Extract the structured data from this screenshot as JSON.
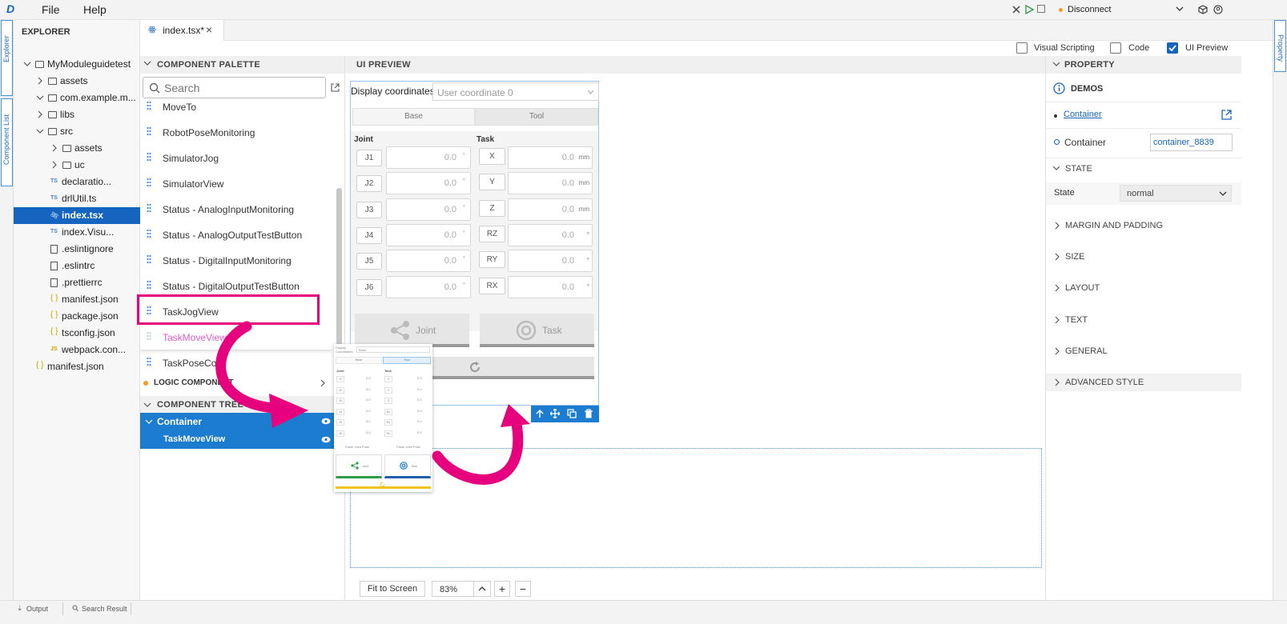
{
  "menu": {
    "file": "File",
    "help": "Help",
    "logo": "D",
    "connection": "Disconnect"
  },
  "rails": {
    "explorer": "Explorer",
    "component_list": "Component List",
    "property": "Property"
  },
  "explorer": {
    "title": "EXPLORER",
    "items": [
      {
        "label": "MyModuleguidetest",
        "kind": "folder",
        "level": 0,
        "open": true
      },
      {
        "label": "assets",
        "kind": "folder",
        "level": 1,
        "open": false
      },
      {
        "label": "com.example.m...",
        "kind": "folder",
        "level": 1,
        "open": true
      },
      {
        "label": "libs",
        "kind": "folder",
        "level": 2,
        "open": false
      },
      {
        "label": "src",
        "kind": "folder",
        "level": 2,
        "open": true
      },
      {
        "label": "assets",
        "kind": "folder",
        "level": 3,
        "open": false
      },
      {
        "label": "uc",
        "kind": "folder",
        "level": 3,
        "open": false
      },
      {
        "label": "declaratio...",
        "kind": "ts",
        "level": 4
      },
      {
        "label": "drlUtil.ts",
        "kind": "ts",
        "level": 4
      },
      {
        "label": "index.tsx",
        "kind": "tsx",
        "level": 4,
        "selected": true
      },
      {
        "label": "index.Visu...",
        "kind": "ts",
        "level": 4
      },
      {
        "label": ".eslintignore",
        "kind": "file",
        "level": 3
      },
      {
        "label": ".eslintrc",
        "kind": "file",
        "level": 3
      },
      {
        "label": ".prettierrc",
        "kind": "file",
        "level": 3
      },
      {
        "label": "manifest.json",
        "kind": "json",
        "level": 3
      },
      {
        "label": "package.json",
        "kind": "json",
        "level": 3
      },
      {
        "label": "tsconfig.json",
        "kind": "json",
        "level": 3
      },
      {
        "label": "webpack.con...",
        "kind": "js",
        "level": 3
      },
      {
        "label": "manifest.json",
        "kind": "json",
        "level": 1
      }
    ],
    "type_badges": {
      "ts": "TS",
      "js": "JS",
      "json": "{ }"
    }
  },
  "editor_tab": {
    "label": "index.tsx*",
    "close": "×"
  },
  "view_toggles": [
    {
      "label": "Visual Scripting",
      "checked": false
    },
    {
      "label": "Code",
      "checked": false
    },
    {
      "label": "UI Preview",
      "checked": true
    }
  ],
  "palette": {
    "title": "COMPONENT PALETTE",
    "search_placeholder": "Search",
    "items": [
      "MoveTo",
      "RobotPoseMonitoring",
      "SimulatorJog",
      "SimulatorView",
      "Status - AnalogInputMonitoring",
      "Status - AnalogOutputTestButton",
      "Status - DigitalInputMonitoring",
      "Status - DigitalOutputTestButton",
      "TaskJogView",
      "TaskMoveView",
      "TaskPoseCon"
    ],
    "highlighted": "TaskJogView",
    "dragging": "TaskMoveView",
    "logic_section": "LOGIC COMPONENT",
    "tree_title": "COMPONENT TREE",
    "tree": [
      {
        "label": "Container"
      },
      {
        "label": "TaskMoveView"
      }
    ]
  },
  "preview": {
    "title": "UI PREVIEW",
    "display_label": "Display coordinates",
    "coord_value": "User coordinate 0",
    "tabs": [
      "Base",
      "Tool"
    ],
    "joint_header": "Joint",
    "task_header": "Task",
    "joints": [
      "J1",
      "J2",
      "J3",
      "J4",
      "J5",
      "J6"
    ],
    "tasks": [
      "X",
      "Y",
      "Z",
      "RZ",
      "RY",
      "RX"
    ],
    "joint_value": "0.0",
    "joint_unit": "°",
    "task_units": [
      "mm",
      "mm",
      "mm",
      "°",
      "°",
      "°"
    ],
    "btn_joint": "Joint",
    "btn_task": "Task",
    "zoom": {
      "fit": "Fit to Screen",
      "value": "83%",
      "plus": "+",
      "minus": "−"
    },
    "ghost": {
      "display": "Display Coordinates",
      "coord": "Base",
      "tabs": [
        "Base",
        "Tool"
      ],
      "joint_header": "Joint",
      "task_header": "Task",
      "joints": [
        "J1",
        "J2",
        "J3",
        "J4",
        "J5",
        "J6"
      ],
      "tasks": [
        "X",
        "Y",
        "Z",
        "Rz",
        "Ry",
        "Rx"
      ],
      "value": "0.0",
      "paste": [
        "Paste Joint Pose",
        "Paste Joint Pose"
      ],
      "btn_joint": "Joint",
      "btn_task": "Task"
    }
  },
  "property": {
    "title": "PROPERTY",
    "demos": "DEMOS",
    "link": "Container",
    "container_label": "Container",
    "container_value": "container_8839",
    "state_section": "STATE",
    "state_label": "State",
    "state_value": "normal",
    "sections": [
      "MARGIN AND PADDING",
      "SIZE",
      "LAYOUT",
      "TEXT",
      "GENERAL",
      "ADVANCED STYLE"
    ]
  },
  "bottom": {
    "output": "Output",
    "search": "Search Result"
  },
  "colors": {
    "accent": "#1565c0",
    "highlight": "#e6007e",
    "drag_text": "#e05cc8"
  }
}
